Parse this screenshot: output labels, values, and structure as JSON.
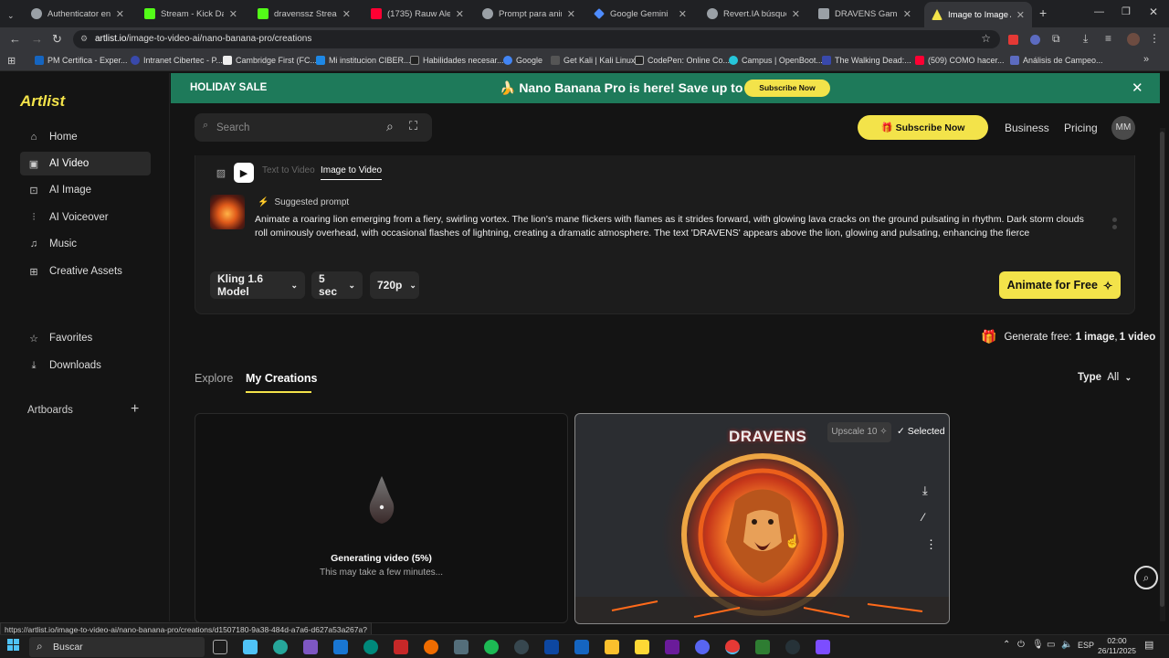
{
  "browser": {
    "tabs": [
      {
        "label": "Authenticator en Kick",
        "color": "#9aa0a6"
      },
      {
        "label": "Stream - Kick Dashbo",
        "color": "#53fc18"
      },
      {
        "label": "dravenssz Stream - W",
        "color": "#53fc18"
      },
      {
        "label": "(1735) Rauw Alejan",
        "color": "#ff0033"
      },
      {
        "label": "Prompt para animació",
        "color": "#9aa0a6"
      },
      {
        "label": "Google Gemini",
        "color": "#4e8cff"
      },
      {
        "label": "Revert.IA búsqueda in",
        "color": "#9aa0a6"
      },
      {
        "label": "DRAVENS Gaming Lo",
        "color": "#9aa0a6"
      },
      {
        "label": "Image to Image AI: S",
        "color": "#f3e34a"
      }
    ],
    "url_host": "artlist.io",
    "url_path": "/image-to-video-ai/nano-banana-pro/creations",
    "bookmarks": [
      "PM Certifica - Exper...",
      "Intranet Cibertec - P...",
      "Cambridge First (FC...",
      "Mi institucion CIBER...",
      "Habilidades necesar...",
      "Google",
      "Get Kali | Kali Linux",
      "CodePen: Online Co...",
      "Campus | OpenBoot...",
      "The Walking Dead:...",
      "(509) COMO hacer...",
      "Análisis de Campeo..."
    ],
    "status_url": "https://artlist.io/image-to-video-ai/nano-banana-pro/creations/d1507180-9a38-484d-a7a6-d627a53a267a?"
  },
  "sidebar": {
    "logo": "Artlist",
    "items": [
      {
        "label": "Home",
        "icon": "home-icon"
      },
      {
        "label": "AI Video",
        "icon": "video-icon"
      },
      {
        "label": "AI Image",
        "icon": "image-icon"
      },
      {
        "label": "AI Voiceover",
        "icon": "voice-icon"
      },
      {
        "label": "Music",
        "icon": "music-icon"
      },
      {
        "label": "Creative Assets",
        "icon": "grid-icon"
      },
      {
        "label": "Favorites",
        "icon": "star-icon"
      },
      {
        "label": "Downloads",
        "icon": "download-icon"
      }
    ],
    "artboards": "Artboards"
  },
  "banner": {
    "left": "HOLIDAY SALE",
    "mid": "🍌 Nano Banana Pro is here! Save up to 40%",
    "button": "Subscribe Now"
  },
  "header": {
    "search_placeholder": "Search",
    "subscribe": "🎁 Subscribe Now",
    "business": "Business",
    "pricing": "Pricing",
    "avatar": "MM"
  },
  "generator": {
    "tab_text": "Text to Video",
    "tab_image": "Image to Video",
    "suggested": "Suggested prompt",
    "prompt": "Animate a roaring lion emerging from a fiery, swirling vortex. The lion's mane flickers with flames as it strides forward, with glowing lava cracks on the ground pulsating in rhythm. Dark storm clouds roll ominously overhead, with occasional flashes of lightning, creating a dramatic atmosphere. The text 'DRAVENS' appears above the lion, glowing and pulsating, enhancing the fierce",
    "model": "Kling 1.6 Model",
    "duration": "5 sec",
    "resolution": "720p",
    "animate": "Animate for Free"
  },
  "credits": {
    "prefix": "Generate free:",
    "images": "1 image",
    "videos": "1 video"
  },
  "creations": {
    "tab_explore": "Explore",
    "tab_mine": "My Creations",
    "type_label": "Type",
    "type_value": "All",
    "generating": "Generating video (5%)",
    "generating_progress": 0.05,
    "waiting": "This may take a few minutes...",
    "upscale": "Upscale 10 ✧",
    "selected": "Selected",
    "card_title": "DRAVENS"
  },
  "taskbar": {
    "search": "Buscar",
    "lang": "ESP",
    "time": "02:00",
    "date": "26/11/2025"
  }
}
